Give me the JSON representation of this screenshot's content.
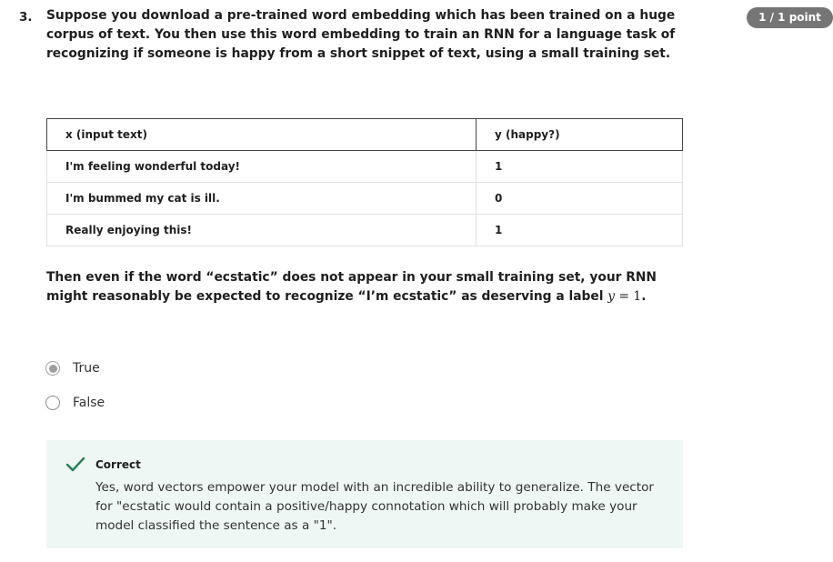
{
  "question": {
    "number": "3.",
    "points": "1 / 1 point",
    "prompt": "Suppose you download a pre-trained word embedding which has been trained on a huge corpus of text. You then use this word embedding to train an RNN for a language task of recognizing if someone is happy from a short snippet of text, using a small training set.",
    "statement_prefix": "Then even if the word “ecstatic” does not appear in your small training set, your RNN might reasonably be expected to recognize “I’m ecstatic” as deserving a label ",
    "statement_math_var": "y",
    "statement_math_rest": " = 1",
    "statement_suffix": "."
  },
  "table": {
    "headers": [
      "x (input text)",
      "y (happy?)"
    ],
    "rows": [
      [
        "I'm feeling wonderful today!",
        "1"
      ],
      [
        "I'm bummed my cat is ill.",
        "0"
      ],
      [
        "Really enjoying this!",
        "1"
      ]
    ]
  },
  "options": [
    {
      "label": "True",
      "selected": true
    },
    {
      "label": "False",
      "selected": false
    }
  ],
  "feedback": {
    "title": "Correct",
    "body": "Yes, word vectors empower your model with an incredible ability to generalize. The vector for \"ecstatic would contain a positive/happy connotation which will probably make your model classified the sentence as a \"1\".",
    "icon": "checkmark-icon",
    "accent_color": "#1f8354",
    "background_color": "#eff7f4"
  },
  "colors": {
    "badge": "#757575",
    "radio_selected": "#9e9e9e"
  }
}
